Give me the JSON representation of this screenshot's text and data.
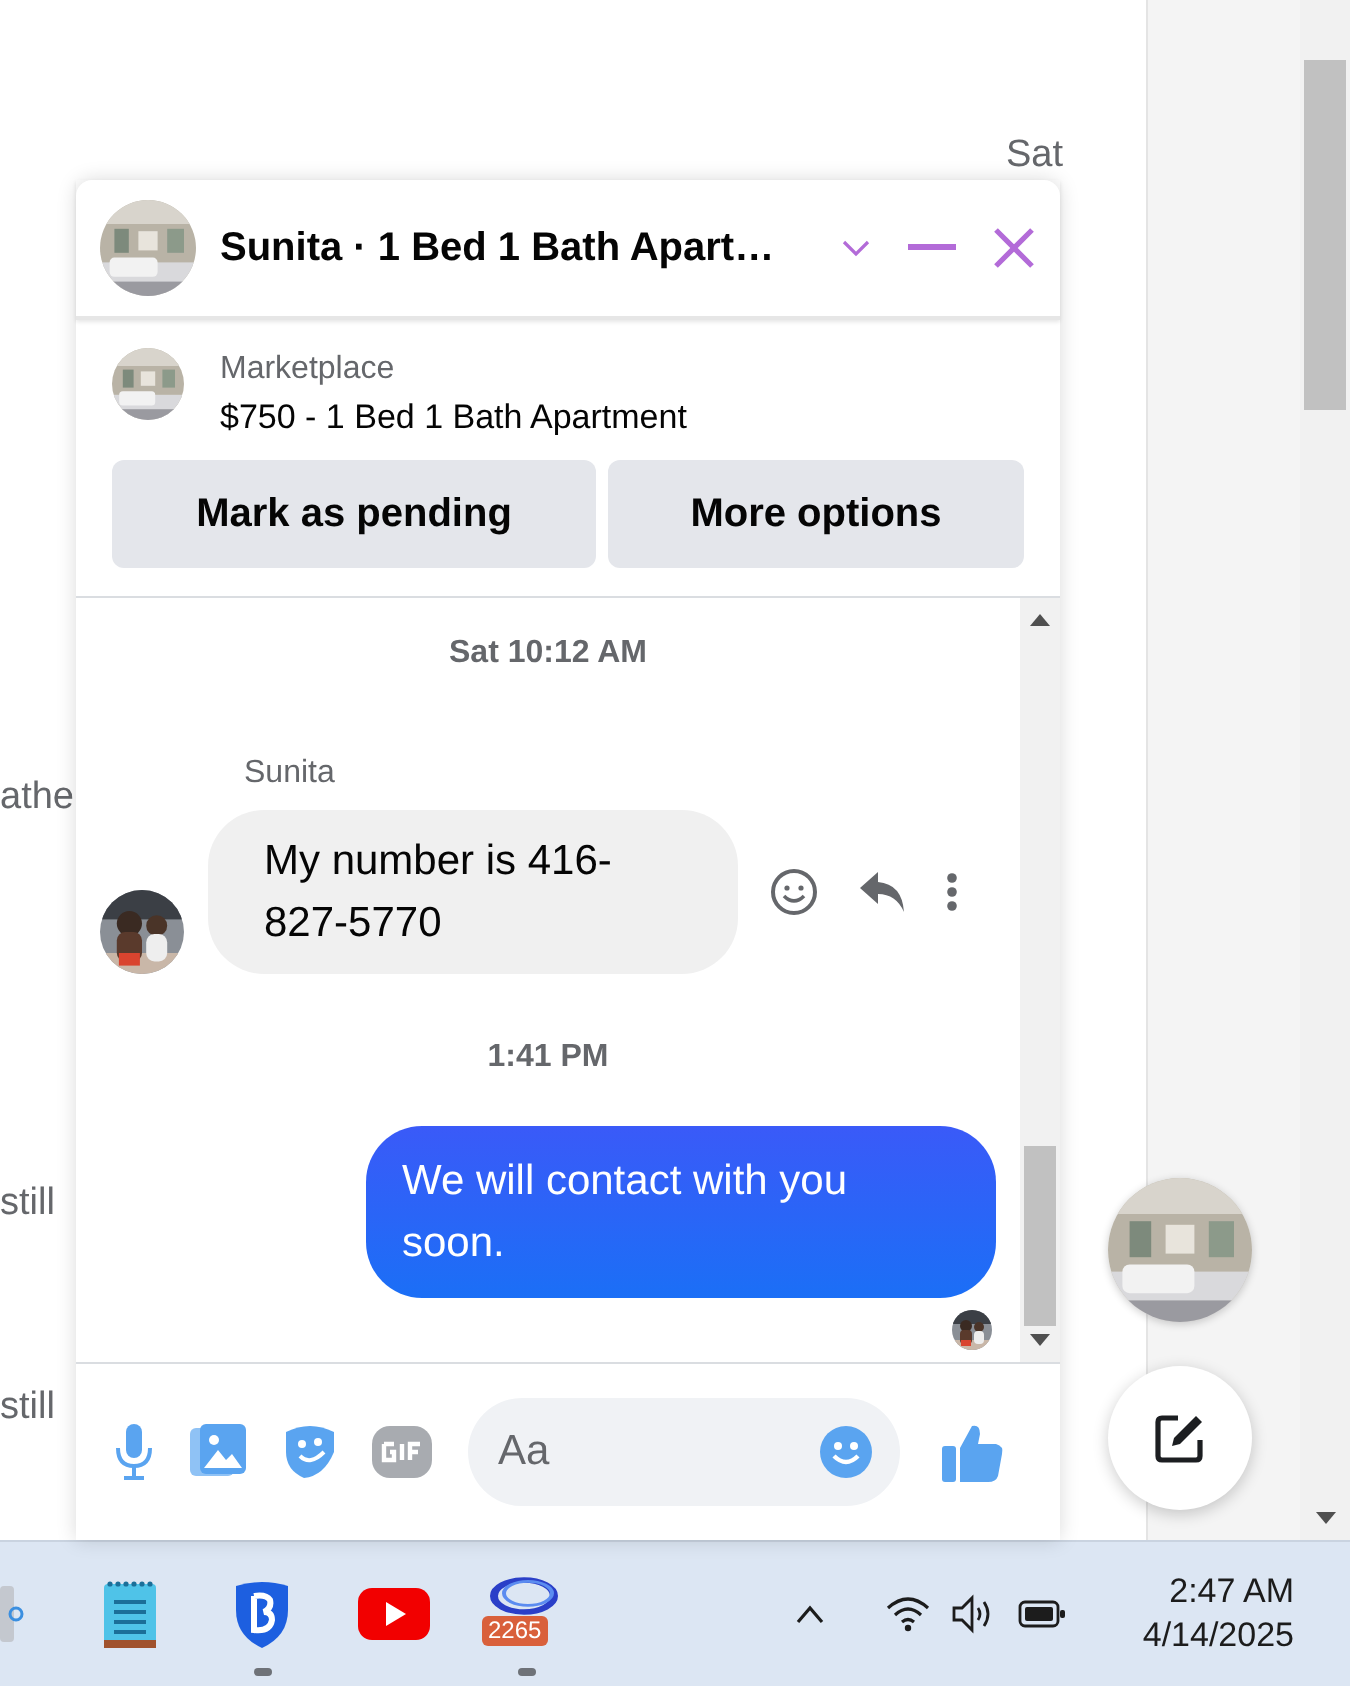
{
  "background_fragments": [
    {
      "text": "Sat"
    },
    {
      "text": "athe"
    },
    {
      "text": "still"
    },
    {
      "text": "still"
    }
  ],
  "chat": {
    "title": "Sunita · 1 Bed 1 Bath Apart…",
    "listing": {
      "source": "Marketplace",
      "title": "$750 - 1 Bed 1 Bath Apartment"
    },
    "actions": [
      "Mark as pending",
      "More options"
    ],
    "messages": [
      {
        "kind": "timestamp",
        "text": "Sat 10:12 AM"
      },
      {
        "kind": "received",
        "sender": "Sunita",
        "text": "My number is 416-827-5770"
      },
      {
        "kind": "timestamp",
        "text": "1:41 PM"
      },
      {
        "kind": "sent",
        "text": "We will contact with you soon."
      }
    ],
    "composer": {
      "placeholder": "Aa"
    }
  },
  "taskbar": {
    "apps": [
      {
        "kind": "notepad",
        "running": false
      },
      {
        "kind": "shield",
        "running": true
      },
      {
        "kind": "video",
        "running": false
      },
      {
        "kind": "ring",
        "running": true,
        "badge": "2265"
      }
    ],
    "clock": {
      "time": "2:47 AM",
      "date": "4/14/2025"
    }
  }
}
